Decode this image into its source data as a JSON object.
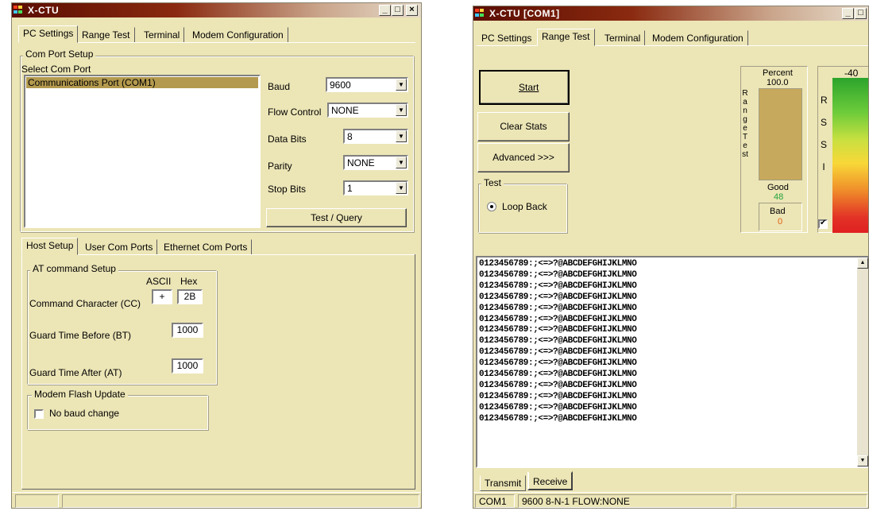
{
  "left_window": {
    "title": "X-CTU",
    "tabs": [
      "PC Settings",
      "Range Test",
      "Terminal",
      "Modem Configuration"
    ],
    "com_port_setup": {
      "group_title": "Com Port Setup",
      "select_label": "Select Com Port",
      "ports": [
        "Communications Port (COM1)"
      ]
    },
    "baud": {
      "label": "Baud",
      "value": "9600"
    },
    "flow_control": {
      "label": "Flow Control",
      "value": "NONE"
    },
    "data_bits": {
      "label": "Data Bits",
      "value": "8"
    },
    "parity": {
      "label": "Parity",
      "value": "NONE"
    },
    "stop_bits": {
      "label": "Stop Bits",
      "value": "1"
    },
    "test_query_label": "Test  / Query",
    "sub_tabs": [
      "Host Setup",
      "User Com Ports",
      "Ethernet Com Ports"
    ],
    "at_command_setup": {
      "group_title": "AT command Setup",
      "ascii_header": "ASCII",
      "hex_header": "Hex",
      "command_character_label": "Command Character (CC)",
      "command_character_ascii": "+",
      "command_character_hex": "2B",
      "guard_time_before_label": "Guard Time Before (BT)",
      "guard_time_before_value": "1000",
      "guard_time_after_label": "Guard Time After (AT)",
      "guard_time_after_value": "1000"
    },
    "modem_flash_update": {
      "group_title": "Modem Flash Update",
      "no_baud_change_label": "No baud change",
      "no_baud_change_checked": false
    }
  },
  "right_window": {
    "title": "X-CTU  [COM1]",
    "tabs": [
      "PC Settings",
      "Range Test",
      "Terminal",
      "Modem Configuration"
    ],
    "start_label": "Start",
    "clear_stats_label": "Clear Stats",
    "advanced_label": "Advanced >>>",
    "test_group": {
      "title": "Test",
      "loop_back_label": "Loop Back",
      "loop_back_selected": true
    },
    "range_test_vertical": "Range Test",
    "percent_label": "Percent",
    "percent_value": "100.0",
    "percent_fill_fraction": 1.0,
    "good_label": "Good",
    "good_value": "48",
    "bad_label": "Bad",
    "bad_value": "0",
    "rssi_vertical": "RSSI",
    "rssi_value": "-40",
    "rssi_checked": true,
    "receive_lines": [
      "0123456789:;<=>?@ABCDEFGHIJKLMNO",
      "0123456789:;<=>?@ABCDEFGHIJKLMNO",
      "0123456789:;<=>?@ABCDEFGHIJKLMNO",
      "0123456789:;<=>?@ABCDEFGHIJKLMNO",
      "0123456789:;<=>?@ABCDEFGHIJKLMNO",
      "0123456789:;<=>?@ABCDEFGHIJKLMNO",
      "0123456789:;<=>?@ABCDEFGHIJKLMNO",
      "0123456789:;<=>?@ABCDEFGHIJKLMNO",
      "0123456789:;<=>?@ABCDEFGHIJKLMNO",
      "0123456789:;<=>?@ABCDEFGHIJKLMNO",
      "0123456789:;<=>?@ABCDEFGHIJKLMNO",
      "0123456789:;<=>?@ABCDEFGHIJKLMNO",
      "0123456789:;<=>?@ABCDEFGHIJKLMNO",
      "0123456789:;<=>?@ABCDEFGHIJKLMNO",
      "0123456789:;<=>?@ABCDEFGHIJKLMNO"
    ],
    "bottom_tabs": [
      "Transmit",
      "Receive"
    ],
    "status": {
      "port": "COM1",
      "settings": "9600 8-N-1  FLOW:NONE"
    }
  },
  "colors": {
    "title_gradient_start": "#5a0d02",
    "window_bg": "#ece5b6",
    "list_selection": "#b49a4e",
    "percent_fill": "#c6a95c",
    "good_value_color": "#22a33a",
    "bad_value_color": "#e06010"
  }
}
